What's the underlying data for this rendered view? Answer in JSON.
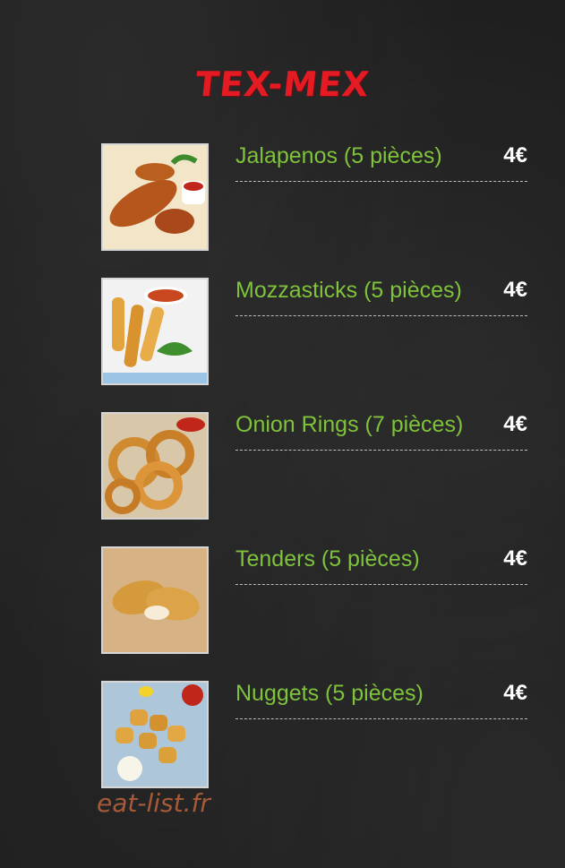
{
  "menu": {
    "title": "TEX-MEX",
    "items": [
      {
        "name": "Jalapenos (5 pièces)",
        "price": "4€",
        "image": "jalapenos-photo"
      },
      {
        "name": "Mozzasticks (5 pièces)",
        "price": "4€",
        "image": "mozzasticks-photo"
      },
      {
        "name": "Onion Rings (7 pièces)",
        "price": "4€",
        "image": "onion-rings-photo"
      },
      {
        "name": "Tenders (5 pièces)",
        "price": "4€",
        "image": "tenders-photo"
      },
      {
        "name": "Nuggets (5 pièces)",
        "price": "4€",
        "image": "nuggets-photo"
      }
    ]
  },
  "watermark": "eat-list.fr",
  "colors": {
    "title": "#e51b24",
    "item_name": "#7ec33b",
    "price": "#ffffff",
    "background": "#1e1e1e"
  }
}
